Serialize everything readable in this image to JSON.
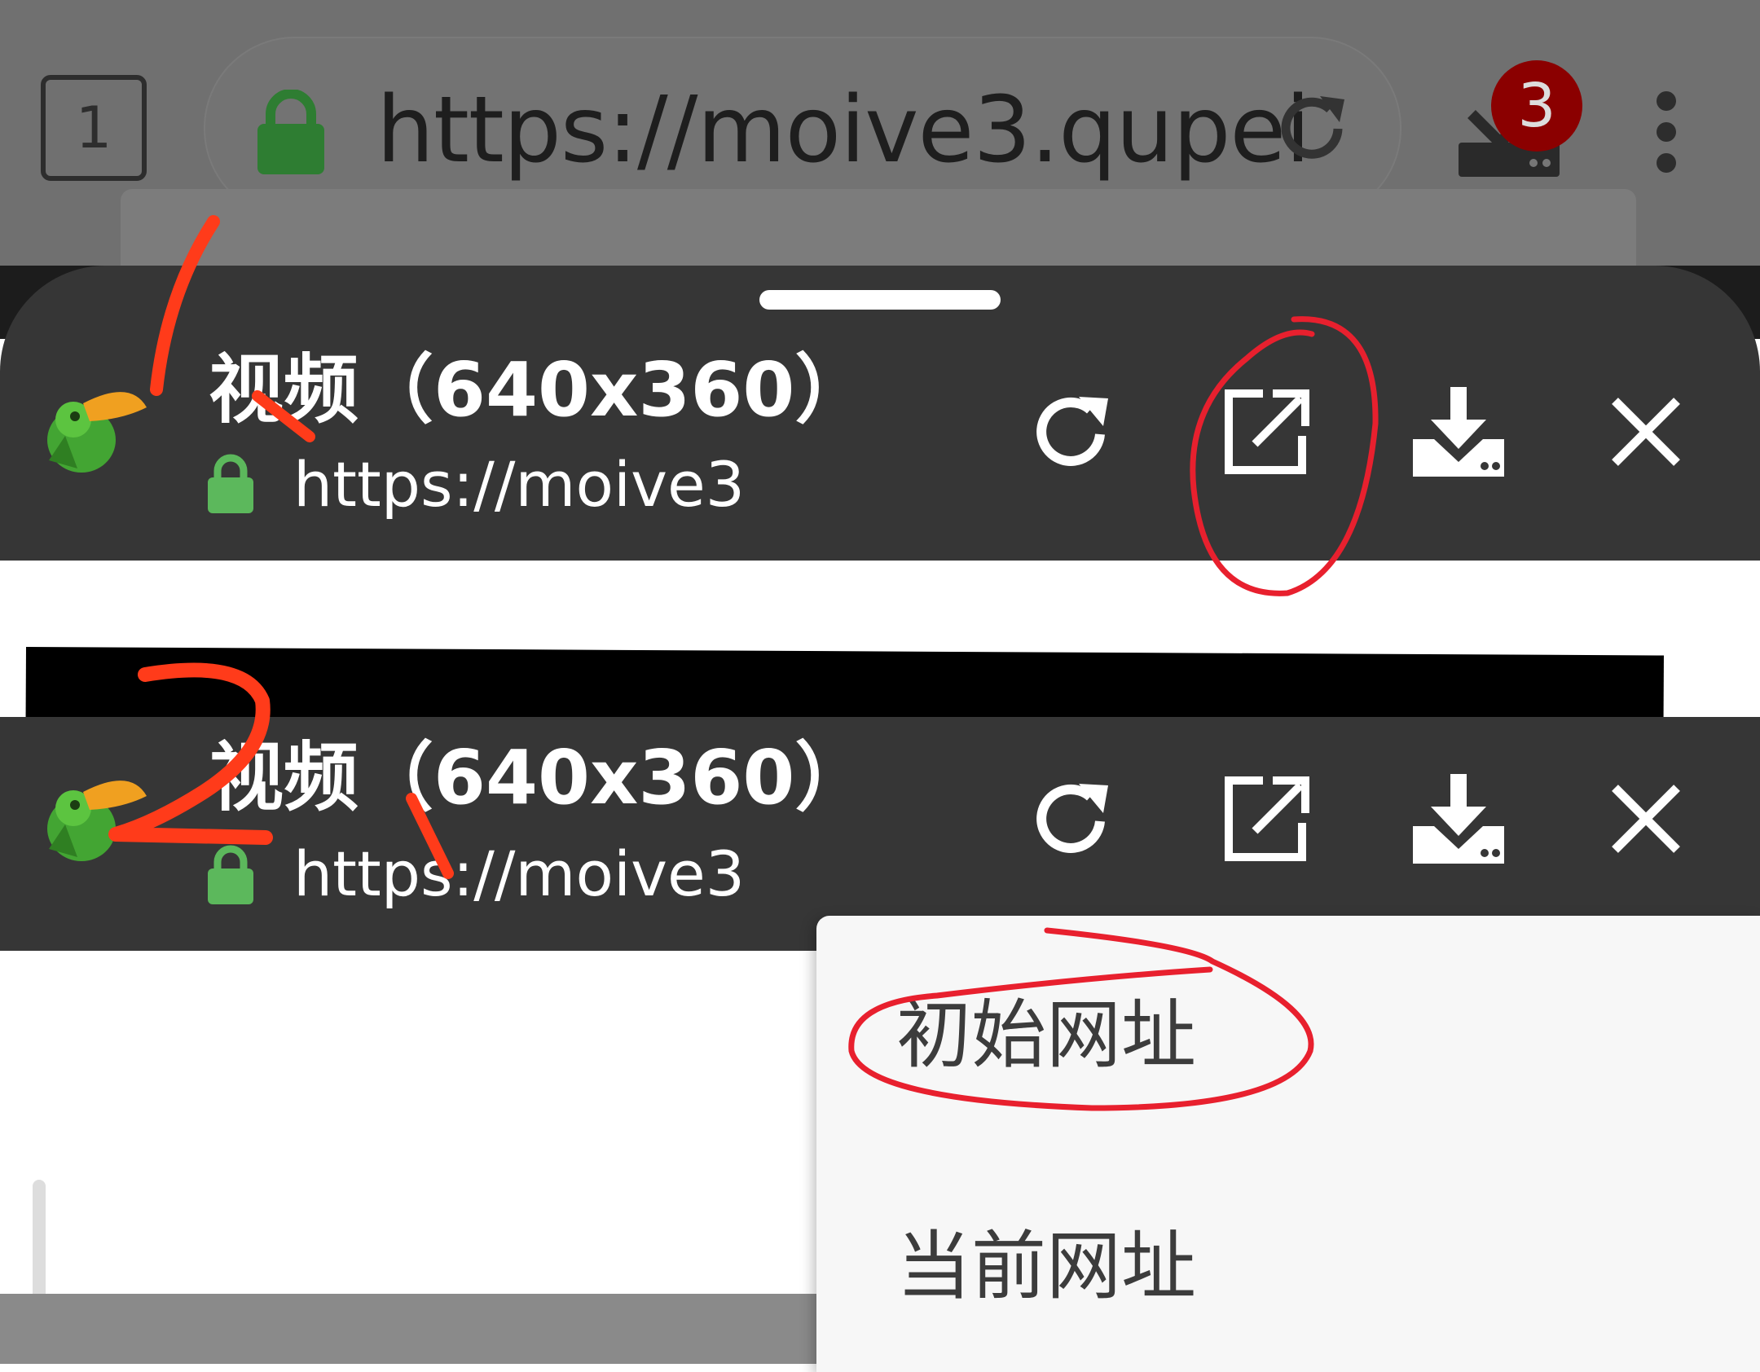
{
  "browser": {
    "tab_count": "1",
    "url": "https://moive3.qupei",
    "downloads_badge": "3",
    "behind_sheet_text": "",
    "icons": {
      "lock": "lock-icon",
      "reload": "reload-icon",
      "downloads": "download-icon",
      "menu": "more-vert-icon"
    }
  },
  "panels": [
    {
      "title": "视频（640x360）",
      "url": "https://moive3"
    },
    {
      "title": "视频（640x360）",
      "url": "https://moive3"
    }
  ],
  "toolbar_icons": [
    "reload-icon",
    "open-external-icon",
    "download-icon",
    "close-icon"
  ],
  "popup_menu": {
    "items": [
      "初始网址",
      "当前网址"
    ]
  },
  "colors": {
    "panel_bg": "#363636",
    "browser_dim": "#707070",
    "lock_green": "#5cb85c",
    "annotation_red": "#e8202e",
    "annotation_orange": "#ff3b1a"
  }
}
